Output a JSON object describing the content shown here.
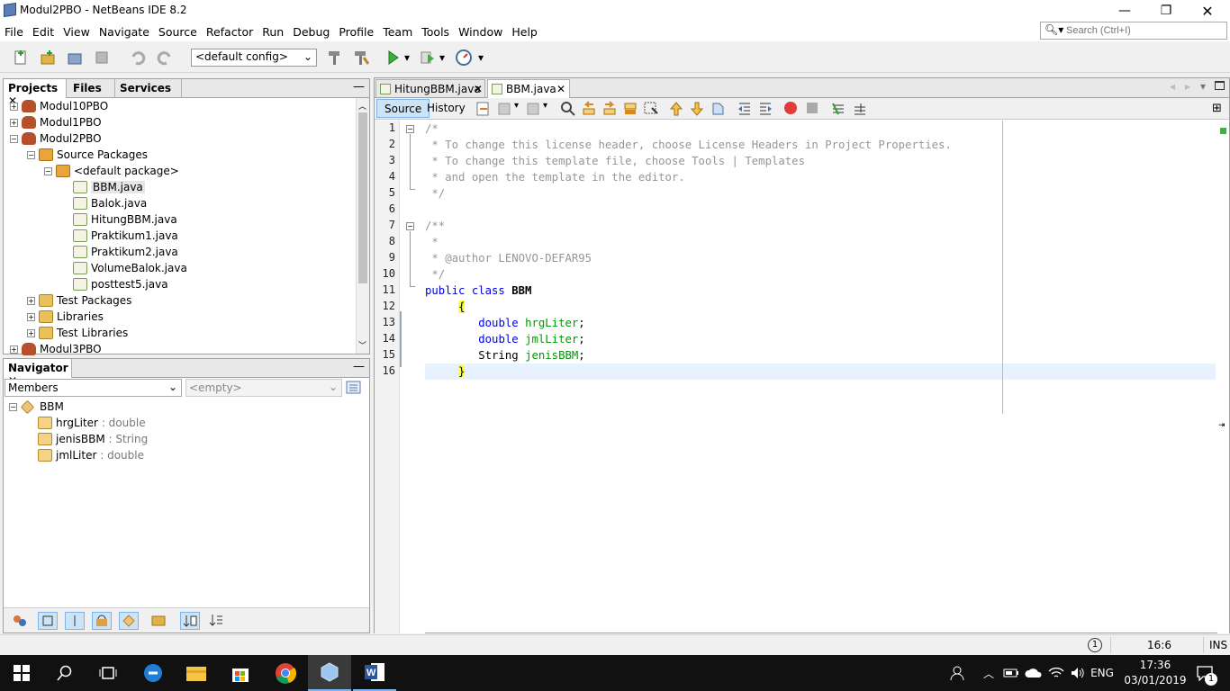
{
  "window": {
    "title": "Modul2PBO - NetBeans IDE 8.2"
  },
  "menu": [
    "File",
    "Edit",
    "View",
    "Navigate",
    "Source",
    "Refactor",
    "Run",
    "Debug",
    "Profile",
    "Team",
    "Tools",
    "Window",
    "Help"
  ],
  "search": {
    "placeholder": "Search (Ctrl+I)"
  },
  "toolbar": {
    "config": "<default config>"
  },
  "projects_panel": {
    "tabs": [
      "Projects",
      "Files",
      "Services"
    ],
    "tree": [
      {
        "label": "Modul10PBO",
        "depth": 0,
        "exp": "+",
        "icon": "coffee"
      },
      {
        "label": "Modul1PBO",
        "depth": 0,
        "exp": "+",
        "icon": "coffee"
      },
      {
        "label": "Modul2PBO",
        "depth": 0,
        "exp": "-",
        "icon": "coffee"
      },
      {
        "label": "Source Packages",
        "depth": 1,
        "exp": "-",
        "icon": "pkg"
      },
      {
        "label": "<default package>",
        "depth": 2,
        "exp": "-",
        "icon": "pkg"
      },
      {
        "label": "BBM.java",
        "depth": 3,
        "exp": "",
        "icon": "jfile",
        "selected": true
      },
      {
        "label": "Balok.java",
        "depth": 3,
        "exp": "",
        "icon": "jfile"
      },
      {
        "label": "HitungBBM.java",
        "depth": 3,
        "exp": "",
        "icon": "jfile"
      },
      {
        "label": "Praktikum1.java",
        "depth": 3,
        "exp": "",
        "icon": "jfile"
      },
      {
        "label": "Praktikum2.java",
        "depth": 3,
        "exp": "",
        "icon": "jfile"
      },
      {
        "label": "VolumeBalok.java",
        "depth": 3,
        "exp": "",
        "icon": "jfile"
      },
      {
        "label": "posttest5.java",
        "depth": 3,
        "exp": "",
        "icon": "jfile"
      },
      {
        "label": "Test Packages",
        "depth": 1,
        "exp": "+",
        "icon": "folder"
      },
      {
        "label": "Libraries",
        "depth": 1,
        "exp": "+",
        "icon": "folder"
      },
      {
        "label": "Test Libraries",
        "depth": 1,
        "exp": "+",
        "icon": "folder"
      },
      {
        "label": "Modul3PBO",
        "depth": 0,
        "exp": "+",
        "icon": "coffee"
      }
    ]
  },
  "navigator": {
    "title": "Navigator",
    "members_label": "Members",
    "empty_label": "<empty>",
    "root": "BBM",
    "members": [
      {
        "name": "hrgLiter",
        "type": " : double"
      },
      {
        "name": "jenisBBM",
        "type": " : String"
      },
      {
        "name": "jmlLiter",
        "type": " : double"
      }
    ]
  },
  "editor": {
    "tabs": [
      "HitungBBM.java",
      "BBM.java"
    ],
    "source_label": "Source",
    "history_label": "History",
    "lines": [
      [
        {
          "t": "/*",
          "c": "cmt"
        }
      ],
      [
        {
          "t": " * To change this license header, choose License Headers in Project Properties.",
          "c": "cmt"
        }
      ],
      [
        {
          "t": " * To change this template file, choose Tools | Templates",
          "c": "cmt"
        }
      ],
      [
        {
          "t": " * and open the template in the editor.",
          "c": "cmt"
        }
      ],
      [
        {
          "t": " */",
          "c": "cmt"
        }
      ],
      [],
      [
        {
          "t": "/**",
          "c": "cmt"
        }
      ],
      [
        {
          "t": " *",
          "c": "cmt"
        }
      ],
      [
        {
          "t": " * @author LENOVO-DEFAR95",
          "c": "cmt"
        }
      ],
      [
        {
          "t": " */",
          "c": "cmt"
        }
      ],
      [
        {
          "t": "public class ",
          "c": "kw"
        },
        {
          "t": "BBM",
          "c": "cls"
        }
      ],
      [
        {
          "t": "     "
        },
        {
          "t": "{",
          "c": "brace"
        }
      ],
      [
        {
          "t": "        "
        },
        {
          "t": "double ",
          "c": "kw"
        },
        {
          "t": "hrgLiter",
          "c": "fld"
        },
        {
          "t": ";"
        }
      ],
      [
        {
          "t": "        "
        },
        {
          "t": "double ",
          "c": "kw"
        },
        {
          "t": "jmlLiter",
          "c": "fld"
        },
        {
          "t": ";"
        }
      ],
      [
        {
          "t": "        String "
        },
        {
          "t": "jenisBBM",
          "c": "fld"
        },
        {
          "t": ";"
        }
      ],
      [
        {
          "t": "     "
        },
        {
          "t": "}",
          "c": "brace"
        }
      ]
    ]
  },
  "status": {
    "position": "16:6",
    "mode": "INS",
    "notifications": "1"
  },
  "taskbar": {
    "lang": "ENG",
    "time": "17:36",
    "date": "03/01/2019",
    "notif_count": "1"
  }
}
